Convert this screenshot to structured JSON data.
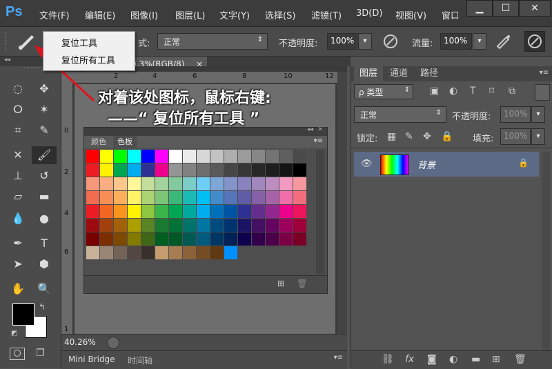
{
  "app": {
    "logo": "Ps"
  },
  "menu": [
    "文件(F)",
    "编辑(E)",
    "图像(I)",
    "图层(L)",
    "文字(Y)",
    "选择(S)",
    "滤镜(T)",
    "3D(D)",
    "视图(V)",
    "窗口"
  ],
  "window_controls": {
    "minimize": "▁",
    "maximize": "☐",
    "close": "✕"
  },
  "options": {
    "mode_label": "式:",
    "mode_value": "正常",
    "opacity_label": "不透明度:",
    "opacity_value": "100%",
    "flow_label": "流量:",
    "flow_value": "100%"
  },
  "context_menu": [
    "复位工具",
    "复位所有工具"
  ],
  "document": {
    "tab_title": "0.3%(RGB/8)",
    "tab_close": "×",
    "zoom": "40.26%",
    "ruler_top": [
      "2",
      "4",
      "6",
      "8",
      "10",
      "12"
    ],
    "ruler_left": [
      "0",
      "2",
      "4",
      "6",
      "1"
    ]
  },
  "swatches_panel": {
    "tabs": [
      "颜色",
      "色板"
    ]
  },
  "swatch_colors": [
    [
      "#ff0000",
      "#ffff00",
      "#00ff00",
      "#00ffff",
      "#0000ff",
      "#ff00ff",
      "#ffffff",
      "#ebebeb",
      "#d7d7d7",
      "#c3c3c3",
      "#afafaf",
      "#9b9b9b",
      "#878787",
      "#737373",
      "#5f5f5f",
      "#4b4b4b"
    ],
    [
      "#ed1c24",
      "#fff200",
      "#00a651",
      "#00aeef",
      "#2e3192",
      "#ec008c",
      "#959595",
      "#828282",
      "#6e6e6e",
      "#5a5a5a",
      "#464646",
      "#373737",
      "#282828",
      "#1e1e1e",
      "#141414",
      "#000000"
    ],
    [
      "#f7977a",
      "#f9ad81",
      "#fdc68a",
      "#fff79a",
      "#c4df9b",
      "#a3d39c",
      "#82ca9d",
      "#7bcdc8",
      "#6ecff6",
      "#7ea7d8",
      "#8493ca",
      "#8882be",
      "#a187be",
      "#bc8dbf",
      "#f49ac2",
      "#f6989d"
    ],
    [
      "#f26c4f",
      "#f68e56",
      "#fbaf5d",
      "#fff467",
      "#acd373",
      "#7cc576",
      "#3bb878",
      "#1abbb4",
      "#00bff3",
      "#438ccb",
      "#5574b9",
      "#605ca8",
      "#855fa8",
      "#a763a8",
      "#f06ea9",
      "#f26d7d"
    ],
    [
      "#ed1c24",
      "#f26522",
      "#f7941d",
      "#fff200",
      "#8dc63f",
      "#39b54a",
      "#00a651",
      "#00a99d",
      "#00aeef",
      "#0072bc",
      "#0054a6",
      "#2e3192",
      "#662d91",
      "#92278f",
      "#ec008c",
      "#ed145b"
    ],
    [
      "#9e0b0f",
      "#a0410d",
      "#a36209",
      "#aba000",
      "#598527",
      "#1a7b30",
      "#007236",
      "#00746b",
      "#0076a3",
      "#004b80",
      "#003471",
      "#1b1464",
      "#440e62",
      "#630460",
      "#9e005d",
      "#9e0039"
    ],
    [
      "#790000",
      "#7b2e00",
      "#7d4900",
      "#827b00",
      "#406618",
      "#005e20",
      "#005826",
      "#005952",
      "#005b7f",
      "#003663",
      "#002157",
      "#0d004c",
      "#32004b",
      "#4b0049",
      "#7b0046",
      "#7a0026"
    ],
    [
      "#c7b299",
      "#998675",
      "#736357",
      "#534741",
      "#37302d",
      "#c69c6e",
      "#a67c52",
      "#8c6239",
      "#754c24",
      "#603913",
      "#0090ff"
    ]
  ],
  "annotation": {
    "line1": "对着该处图标，鼠标右键:",
    "line2": "——“ 复位所有工具 ”"
  },
  "layers": {
    "tabs": [
      "图层",
      "通道",
      "路径"
    ],
    "kind_label": "ρ 类型",
    "blend": "正常",
    "opacity_label": "不透明度:",
    "opacity_value": "100%",
    "lock_label": "锁定:",
    "fill_label": "填充:",
    "fill_value": "100%",
    "layer_name": "背景"
  },
  "bottom_tabs": [
    "Mini Bridge",
    "时间轴"
  ]
}
